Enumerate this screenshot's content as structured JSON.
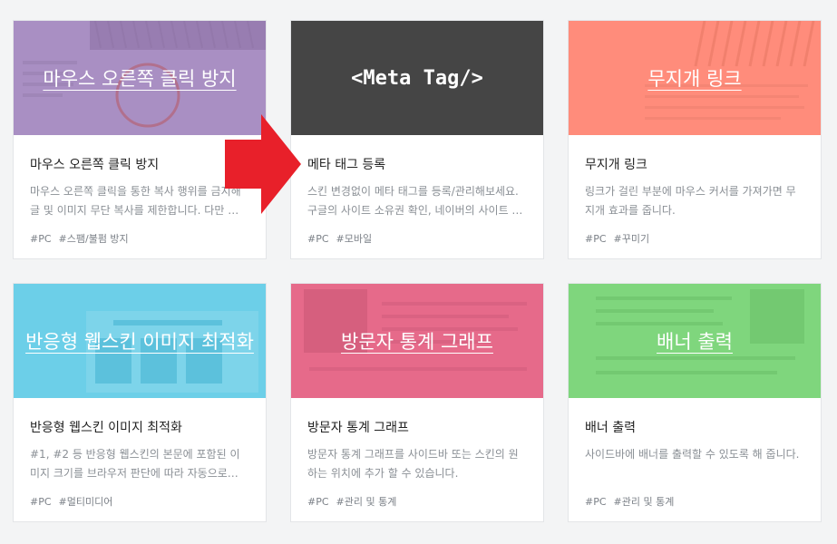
{
  "cards": [
    {
      "thumb_title": "마우스 오른쪽 클릭 방지",
      "title": "마우스 오른쪽 클릭 방지",
      "desc": "마우스 오른쪽 클릭을 통한 복사 행위를 금지해 글 및 이미지 무단 복사를 제한합니다. 다만 …",
      "tags": [
        "#PC",
        "#스팸/불펌 방지"
      ],
      "color": "#a98fc3"
    },
    {
      "thumb_title": "<Meta Tag/>",
      "title": "메타 태그 등록",
      "desc": "스킨 변경없이 메타 태그를 등록/관리해보세요. 구글의 사이트 소유권 확인, 네이버의 사이트 …",
      "tags": [
        "#PC",
        "#모바일"
      ],
      "color": "#454545"
    },
    {
      "thumb_title": "무지개 링크",
      "title": "무지개 링크",
      "desc": "링크가 걸린 부분에 마우스 커서를 가져가면 무지개 효과를 줍니다.",
      "tags": [
        "#PC",
        "#꾸미기"
      ],
      "color": "#ff8c7b"
    },
    {
      "thumb_title": "반응형 웹스킨 이미지 최적화",
      "title": "반응형 웹스킨 이미지 최적화",
      "desc": "#1, #2 등 반응형 웹스킨의 본문에 포함된 이미지 크기를 브라우저 판단에 따라 자동으로 조…",
      "tags": [
        "#PC",
        "#멀티미디어"
      ],
      "color": "#6ccfe8"
    },
    {
      "thumb_title": "방문자 통계 그래프",
      "title": "방문자 통계 그래프",
      "desc": "방문자 통계 그래프를 사이드바 또는 스킨의 원하는 위치에 추가 할 수 있습니다.",
      "tags": [
        "#PC",
        "#관리 및 통계"
      ],
      "color": "#e66a8a"
    },
    {
      "thumb_title": "배너 출력",
      "title": "배너 출력",
      "desc": "사이드바에 배너를 출력할 수 있도록 해 줍니다.",
      "tags": [
        "#PC",
        "#관리 및 통계"
      ],
      "color": "#7fd67d"
    }
  ],
  "arrow_color": "#e8202a"
}
